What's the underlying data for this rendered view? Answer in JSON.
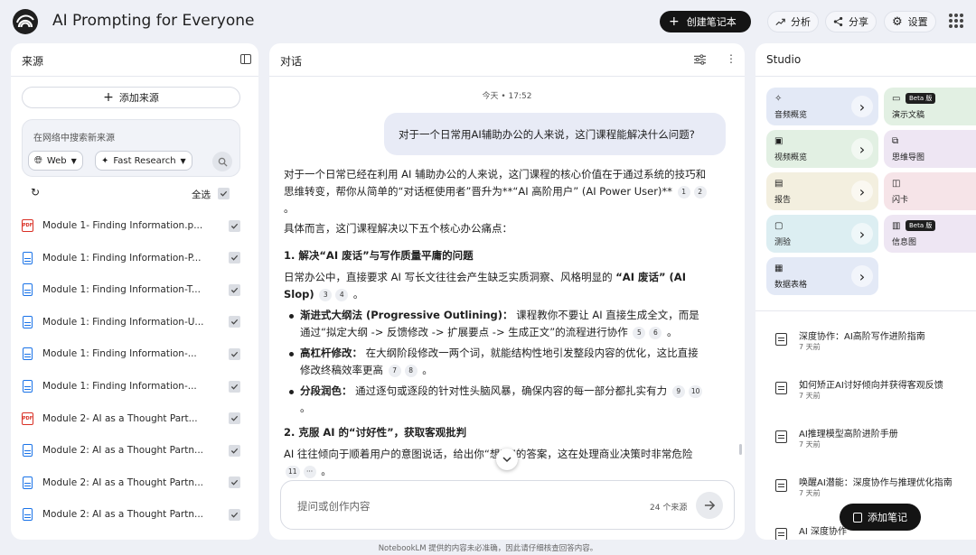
{
  "header": {
    "title": "AI Prompting for Everyone",
    "create_label": "创建笔记本",
    "analyze_label": "分析",
    "share_label": "分享",
    "settings_label": "设置"
  },
  "sources": {
    "title": "来源",
    "add_label": "添加来源",
    "search_placeholder": "在网络中搜索新来源",
    "web_chip": "Web",
    "research_chip": "Fast Research",
    "select_all": "全选",
    "items": [
      {
        "type": "pdf",
        "name": "Module 1- Finding Information.p..."
      },
      {
        "type": "doc",
        "name": "Module 1: Finding Information-P..."
      },
      {
        "type": "doc",
        "name": "Module 1: Finding Information-T..."
      },
      {
        "type": "doc",
        "name": "Module 1: Finding Information-U..."
      },
      {
        "type": "doc",
        "name": "Module 1: Finding Information-..."
      },
      {
        "type": "doc",
        "name": "Module 1: Finding Information-..."
      },
      {
        "type": "pdf",
        "name": "Module 2- AI as a Thought Part..."
      },
      {
        "type": "doc",
        "name": "Module 2: AI as a Thought Partn..."
      },
      {
        "type": "doc",
        "name": "Module 2: AI as a Thought Partn..."
      },
      {
        "type": "doc",
        "name": "Module 2: AI as a Thought Partn..."
      }
    ]
  },
  "chat": {
    "title": "对话",
    "time": "今天 • 17:52",
    "user_message": "对于一个日常用AI辅助办公的人来说，这门课程能解决什么问题?",
    "p1": "对于一个日常已经在利用 AI 辅助办公的人来说，这门课程的核心价值在于通过系统的技巧和思维转变，帮你从简单的“对话框使用者”晋升为**“AI 高阶用户” (AI Power User)**",
    "p2": "具体而言，这门课程解决以下五个核心办公痛点：",
    "h1": "1. 解决“AI 废话”与写作质量平庸的问题",
    "p3a": "日常办公中，直接要求 AI 写长文往往会产生缺乏实质洞察、风格明显的 ",
    "p3b": "“AI 废话” (AI Slop)",
    "b1a": "渐进式大纲法 (Progressive Outlining)：",
    "b1b": " 课程教你不要让 AI 直接生成全文，而是通过“拟定大纲 -> 反馈修改 -> 扩展要点 -> 生成正文”的流程进行协作",
    "b2a": "高杠杆修改：",
    "b2b": " 在大纲阶段修改一两个词，就能结构性地引发整段内容的优化，这比直接修改终稿效率更高",
    "b3a": "分段润色：",
    "b3b": " 通过逐句或逐段的针对性头脑风暴，确保内容的每一部分都扎实有力",
    "h2": "2. 克服 AI 的“讨好性”，获取客观批判",
    "p4": "AI 往往倾向于顺着用户的意图说话，给出你“想听”的答案，这在处理商业决策时非常危险",
    "cites": {
      "c1": "1",
      "c2": "2",
      "c3": "3",
      "c4": "4",
      "c5": "5",
      "c6": "6",
      "c7": "7",
      "c8": "8",
      "c9": "9",
      "c10": "10",
      "c11": "11",
      "c12": "···"
    },
    "input_placeholder": "提问或创作内容",
    "source_count": "24 个来源"
  },
  "studio": {
    "title": "Studio",
    "beta": "Beta 版",
    "tiles": {
      "audio": "音频概览",
      "slides": "演示文稿",
      "video": "视频概览",
      "mindmap": "思维导图",
      "report": "报告",
      "flashcards": "闪卡",
      "quiz": "测验",
      "infographic": "信息图",
      "table": "数据表格"
    },
    "notes": [
      {
        "title": "深度协作：AI高阶写作进阶指南",
        "time": "7 天前"
      },
      {
        "title": "如何矫正AI讨好倾向并获得客观反馈",
        "time": "7 天前"
      },
      {
        "title": "AI推理模型高阶进阶手册",
        "time": "7 天前"
      },
      {
        "title": "唤醒AI潜能：深度协作与推理优化指南",
        "time": "7 天前"
      },
      {
        "title": "AI 深度协作",
        "time": ""
      }
    ],
    "add_note": "添加笔记",
    "colors": {
      "blue": "#e3e9f6",
      "green": "#e2f0e3",
      "purple": "#eee6f3",
      "yellow": "#f3efdf",
      "pink": "#f6e4e8",
      "teal": "#dceef2"
    }
  },
  "footer": "NotebookLM 提供的内容未必准确，因此请仔细核查回答内容。"
}
